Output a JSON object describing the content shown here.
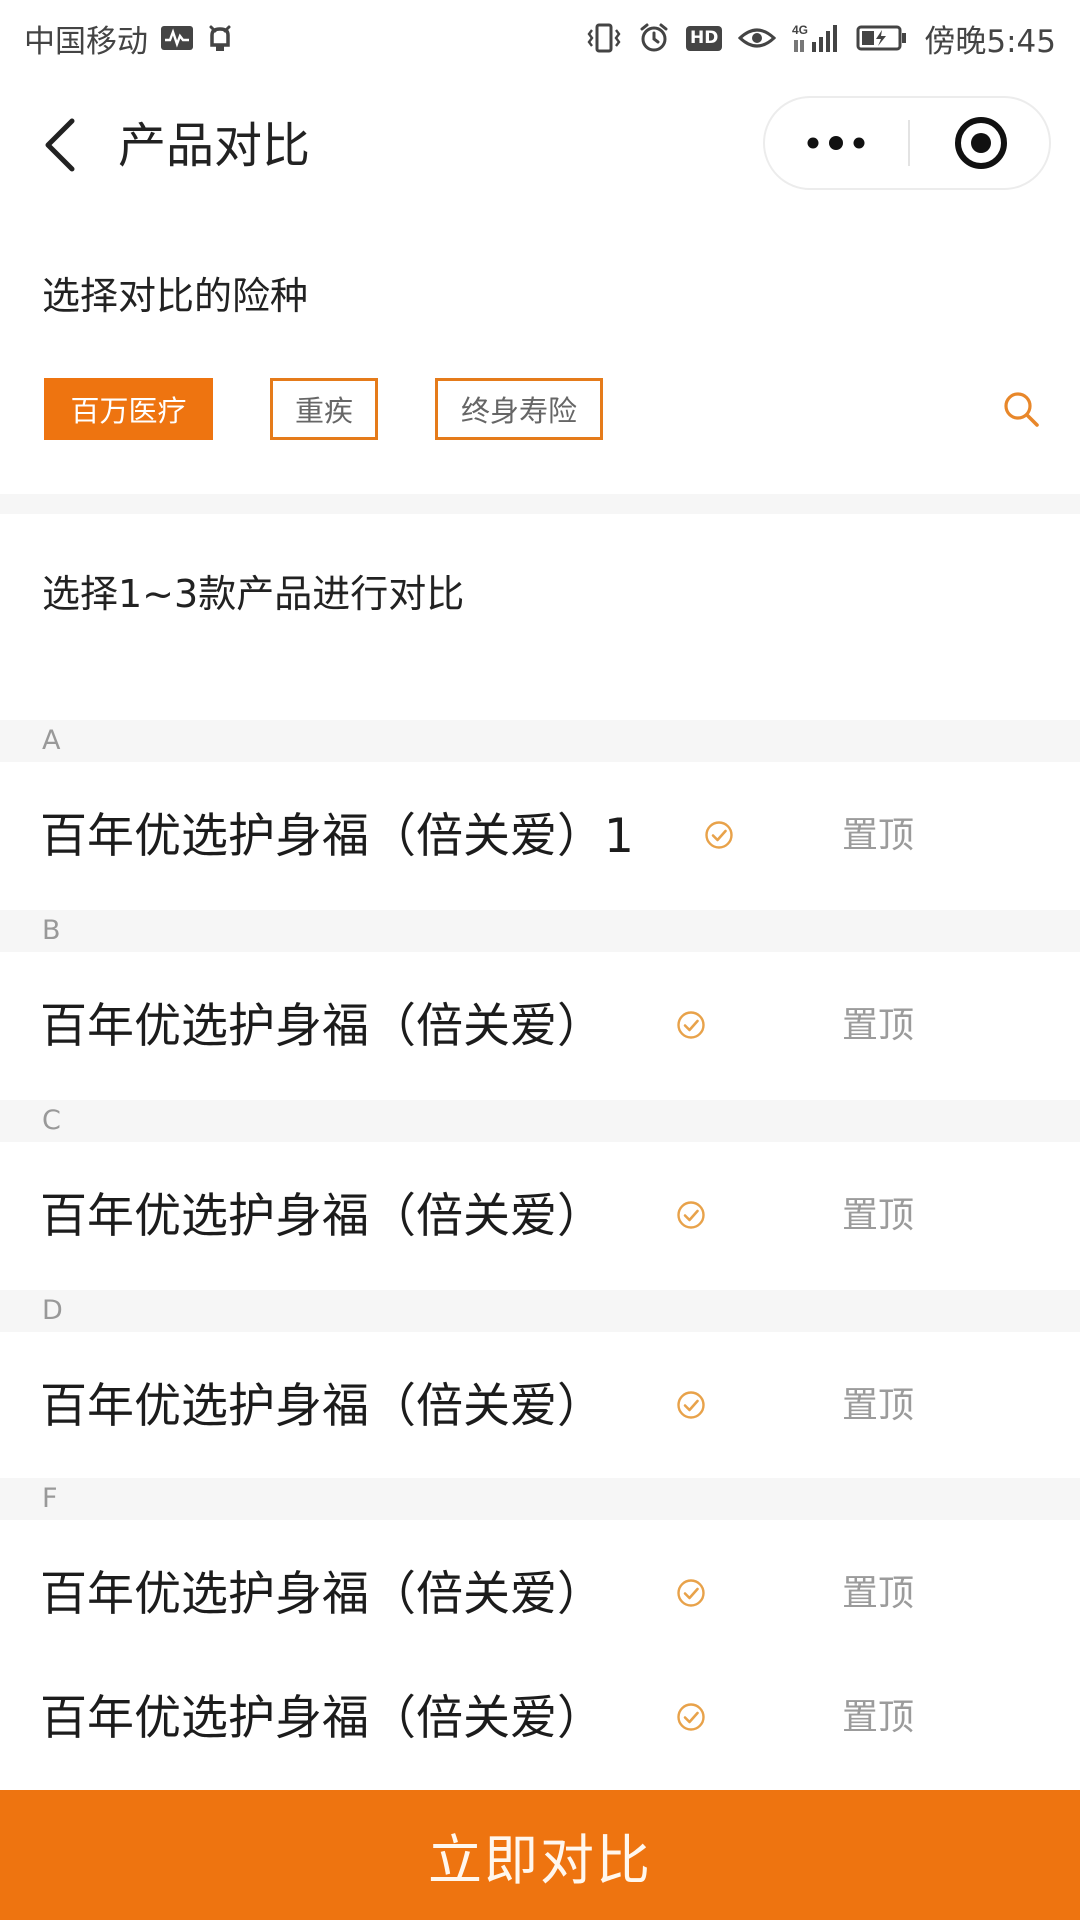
{
  "status_bar": {
    "carrier": "中国移动",
    "hd_label": "HD",
    "network": "4G",
    "time": "傍晚5:45"
  },
  "header": {
    "title": "产品对比"
  },
  "insurance_types": {
    "heading": "选择对比的险种",
    "tags": [
      {
        "label": "百万医疗",
        "active": true
      },
      {
        "label": "重疾",
        "active": false
      },
      {
        "label": "终身寿险",
        "active": false
      }
    ]
  },
  "products": {
    "heading": "选择1~3款产品进行对比",
    "groups": [
      {
        "letter": "A",
        "name": "百年优选护身福（倍关爱）1",
        "pin_label": "置顶"
      },
      {
        "letter": "B",
        "name": "百年优选护身福（倍关爱）",
        "pin_label": "置顶"
      },
      {
        "letter": "C",
        "name": "百年优选护身福（倍关爱）",
        "pin_label": "置顶"
      },
      {
        "letter": "D",
        "name": "百年优选护身福（倍关爱）",
        "pin_label": "置顶"
      },
      {
        "letter": "F",
        "name": "百年优选护身福（倍关爱）",
        "pin_label": "置顶"
      },
      {
        "letter": "",
        "name": "百年优选护身福（倍关爱）",
        "pin_label": "置顶"
      }
    ]
  },
  "footer": {
    "compare_label": "立即对比"
  },
  "colors": {
    "accent": "#ee7410",
    "tag_border": "#e57b1a",
    "muted_text": "#9b9b9b",
    "band_background": "#f6f6f6"
  }
}
